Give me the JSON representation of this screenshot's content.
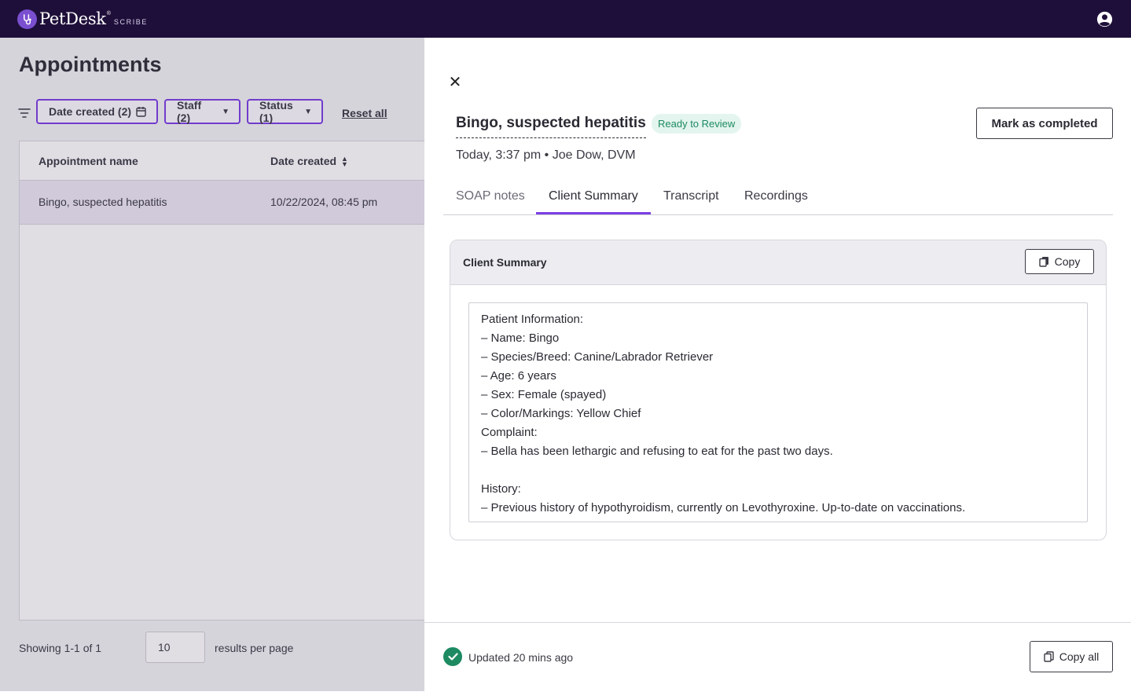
{
  "app": {
    "brand": "PetDesk",
    "brand_reg": "®",
    "brand_sub": "SCRIBE",
    "brand_color": "#1e0f3a",
    "accent": "#7b3fe4",
    "account_icon": "account-circle-icon"
  },
  "appointments": {
    "title": "Appointments",
    "filters": {
      "date_label": "Date created (2)",
      "staff_label": "Staff (2)",
      "status_label": "Status (1)",
      "reset_label": "Reset all"
    },
    "table": {
      "columns": [
        "Appointment name",
        "Date created"
      ],
      "rows": [
        {
          "name": "Bingo, suspected hepatitis",
          "date": "10/22/2024, 08:45 pm"
        }
      ]
    },
    "pagination": {
      "showing": "Showing 1-1 of 1",
      "per_page_value": "10",
      "per_page_label": "results per page"
    }
  },
  "drawer": {
    "title": "Bingo, suspected hepatitis",
    "status": "Ready to Review",
    "status_color": "#1d8a62",
    "mark_completed_label": "Mark as completed",
    "meta": "Today, 3:37 pm • Joe Dow, DVM",
    "tabs": [
      {
        "label": "SOAP notes",
        "active": false
      },
      {
        "label": "Client Summary",
        "active": true
      },
      {
        "label": "Transcript",
        "active": false
      },
      {
        "label": "Recordings",
        "active": false
      }
    ],
    "summary_card": {
      "title": "Client Summary",
      "copy_label": "Copy",
      "lines": [
        "Patient Information:",
        "– Name: Bingo",
        "– Species/Breed: Canine/Labrador Retriever",
        "– Age: 6 years",
        "– Sex: Female (spayed)",
        "– Color/Markings: Yellow Chief",
        "Complaint:",
        "– Bella has been lethargic and refusing to eat for the past two days.",
        "",
        "History:",
        "– Previous history of hypothyroidism, currently on Levothyroxine. Up-to-date on vaccinations."
      ]
    },
    "footer": {
      "updated": "Updated 20 mins ago",
      "copy_all_label": "Copy all"
    }
  }
}
